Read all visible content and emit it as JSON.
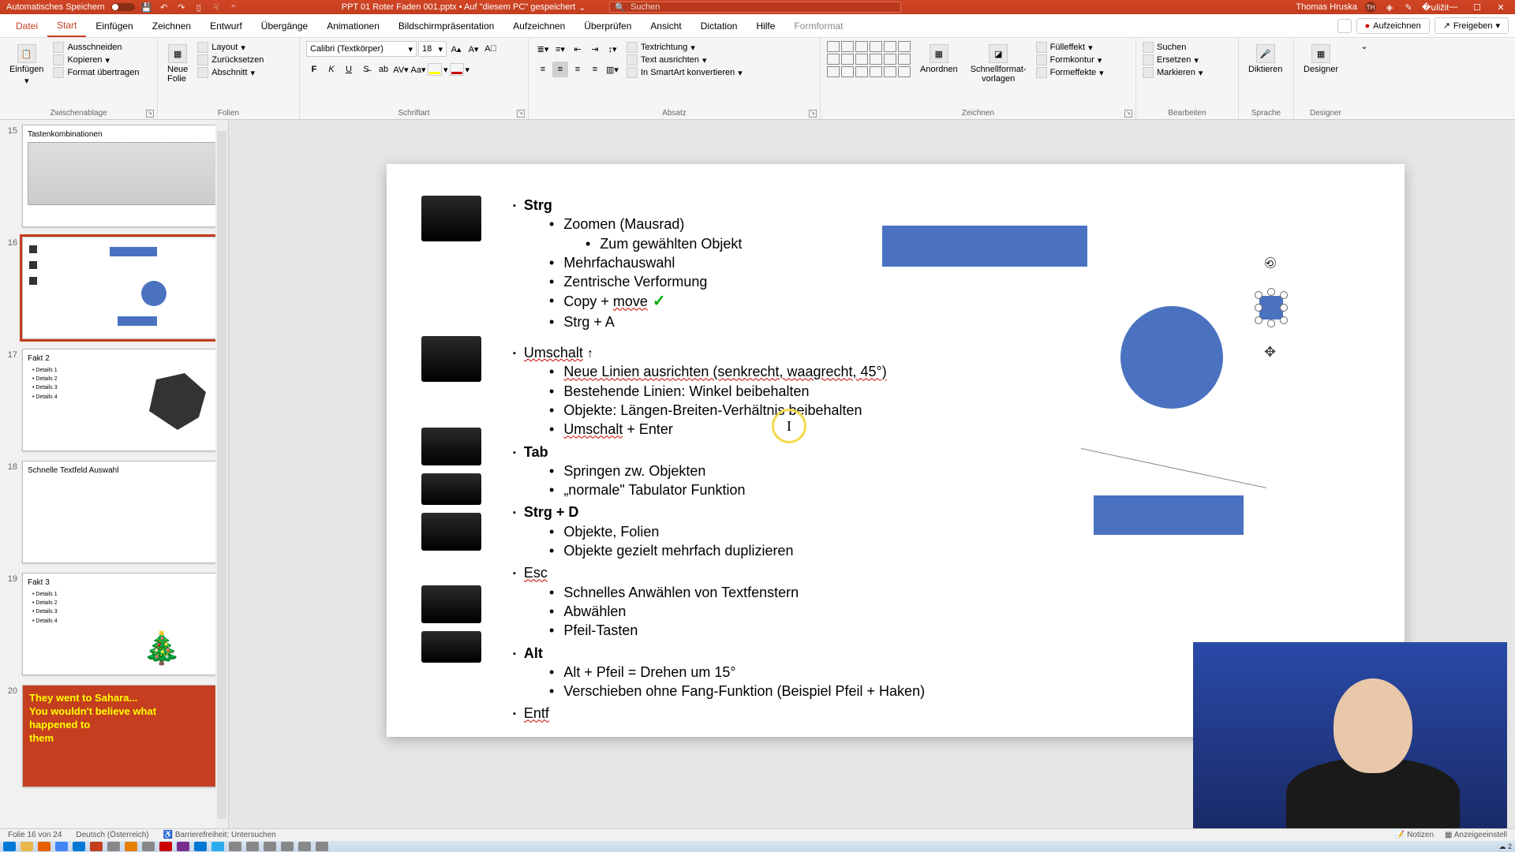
{
  "titlebar": {
    "autosave": "Automatisches Speichern",
    "filename": "PPT 01 Roter Faden 001.pptx • Auf \"diesem PC\" gespeichert",
    "search_placeholder": "Suchen",
    "user": "Thomas Hruska",
    "initials": "TH"
  },
  "menu": {
    "tabs": [
      "Datei",
      "Start",
      "Einfügen",
      "Zeichnen",
      "Entwurf",
      "Übergänge",
      "Animationen",
      "Bildschirmpräsentation",
      "Aufzeichnen",
      "Überprüfen",
      "Ansicht",
      "Dictation",
      "Hilfe",
      "Formformat"
    ],
    "active": "Start",
    "record": "Aufzeichnen",
    "share": "Freigeben"
  },
  "ribbon": {
    "clipboard": {
      "label": "Zwischenablage",
      "paste": "Einfügen",
      "cut": "Ausschneiden",
      "copy": "Kopieren",
      "format": "Format übertragen"
    },
    "slides": {
      "label": "Folien",
      "new": "Neue\nFolie",
      "layout": "Layout",
      "reset": "Zurücksetzen",
      "section": "Abschnitt"
    },
    "font": {
      "label": "Schriftart",
      "name": "Calibri (Textkörper)",
      "size": "18"
    },
    "para": {
      "label": "Absatz",
      "textdir": "Textrichtung",
      "align": "Text ausrichten",
      "smartart": "In SmartArt konvertieren"
    },
    "draw": {
      "label": "Zeichnen",
      "arrange": "Anordnen",
      "quick": "Schnellformat-\nvorlagen",
      "fill": "Fülleffekt",
      "outline": "Formkontur",
      "effects": "Formeffekte"
    },
    "edit": {
      "label": "Bearbeiten",
      "find": "Suchen",
      "replace": "Ersetzen",
      "select": "Markieren"
    },
    "voice": {
      "label": "Sprache",
      "dictate": "Diktieren"
    },
    "designer": {
      "label": "Designer",
      "btn": "Designer"
    }
  },
  "thumbs": [
    {
      "num": "15",
      "title": "Tastenkombinationen"
    },
    {
      "num": "16",
      "title": ""
    },
    {
      "num": "17",
      "title": "Fakt 2"
    },
    {
      "num": "18",
      "title": "Schnelle Textfeld Auswahl"
    },
    {
      "num": "19",
      "title": "Fakt 3"
    },
    {
      "num": "20",
      "title": ""
    }
  ],
  "slide": {
    "strg": {
      "h": "Strg",
      "items": [
        "Zoomen (Mausrad)",
        "Zum gewählten Objekt",
        "Mehrfachauswahl",
        "Zentrische Verformung",
        "Copy + move",
        "Strg + A"
      ]
    },
    "umschalt": {
      "h": "Umschalt",
      "items": [
        "Neue Linien ausrichten (senkrecht, waagrecht, 45°)",
        "Bestehende Linien: Winkel beibehalten",
        "Objekte: Längen-Breiten-Verhältnis beibehalten",
        "Umschalt + Enter"
      ]
    },
    "tab": {
      "h": "Tab",
      "items": [
        "Springen zw. Objekten",
        "„normale\" Tabulator Funktion"
      ]
    },
    "strgd": {
      "h": "Strg + D",
      "items": [
        "Objekte, Folien",
        "Objekte gezielt mehrfach duplizieren"
      ]
    },
    "esc": {
      "h": "Esc",
      "items": [
        "Schnelles Anwählen von Textfenstern",
        "Abwählen",
        "Pfeil-Tasten"
      ]
    },
    "alt": {
      "h": "Alt",
      "items": [
        "Alt + Pfeil = Drehen um 15°",
        "Verschieben ohne Fang-Funktion (Beispiel Pfeil + Haken)"
      ]
    },
    "entf": {
      "h": "Entf"
    }
  },
  "status": {
    "slide": "Folie 16 von 24",
    "lang": "Deutsch (Österreich)",
    "access": "Barrierefreiheit: Untersuchen",
    "notes": "Notizen",
    "display": "Anzeigeeinstell"
  },
  "taskbar": {
    "weather": "2"
  }
}
